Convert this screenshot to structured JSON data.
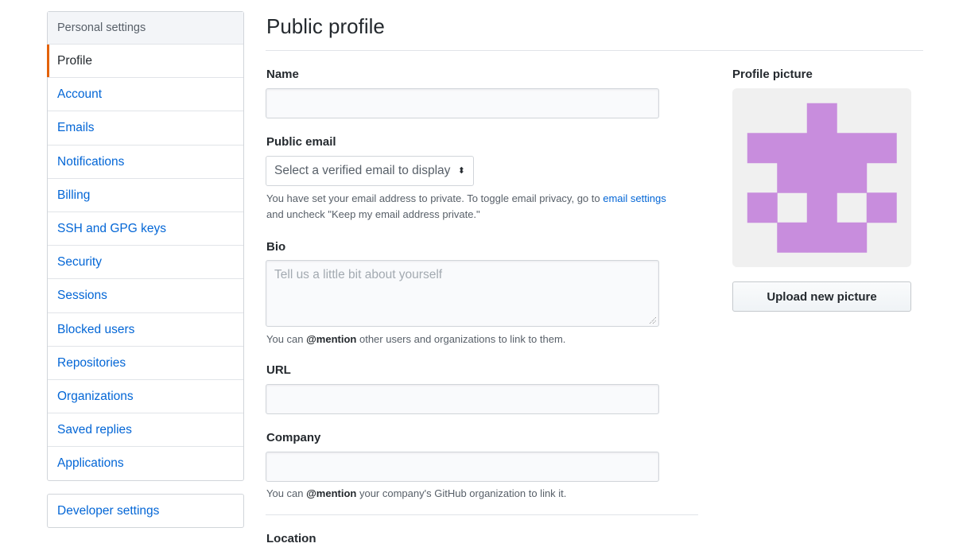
{
  "sidebar": {
    "heading": "Personal settings",
    "items": [
      {
        "label": "Profile",
        "selected": true
      },
      {
        "label": "Account"
      },
      {
        "label": "Emails"
      },
      {
        "label": "Notifications"
      },
      {
        "label": "Billing"
      },
      {
        "label": "SSH and GPG keys"
      },
      {
        "label": "Security"
      },
      {
        "label": "Sessions"
      },
      {
        "label": "Blocked users"
      },
      {
        "label": "Repositories"
      },
      {
        "label": "Organizations"
      },
      {
        "label": "Saved replies"
      },
      {
        "label": "Applications"
      }
    ],
    "developer_settings": "Developer settings",
    "accent_color": "#e36209"
  },
  "main": {
    "title": "Public profile",
    "name": {
      "label": "Name",
      "value": ""
    },
    "public_email": {
      "label": "Public email",
      "selected": "Select a verified email to display",
      "note_before": "You have set your email address to private. To toggle email privacy, go to ",
      "note_link": "email settings",
      "note_after": "and uncheck \"Keep my email address private.\""
    },
    "bio": {
      "label": "Bio",
      "placeholder": "Tell us a little bit about yourself",
      "value": "",
      "note_prefix": "You can ",
      "note_mention": "@mention",
      "note_suffix": " other users and organizations to link to them."
    },
    "url": {
      "label": "URL",
      "value": ""
    },
    "company": {
      "label": "Company",
      "value": "",
      "note_prefix": "You can ",
      "note_mention": "@mention",
      "note_suffix": " your company's GitHub organization to link it."
    },
    "location": {
      "label": "Location"
    }
  },
  "profile_picture": {
    "label": "Profile picture",
    "upload_button": "Upload new picture",
    "identicon_color": "#c88ddd",
    "identicon_background": "#f0f0f0",
    "identicon_grid": [
      [
        0,
        0,
        1,
        0,
        0
      ],
      [
        1,
        1,
        1,
        1,
        1
      ],
      [
        0,
        1,
        1,
        1,
        0
      ],
      [
        1,
        0,
        1,
        0,
        1
      ],
      [
        0,
        1,
        1,
        1,
        0
      ]
    ]
  }
}
